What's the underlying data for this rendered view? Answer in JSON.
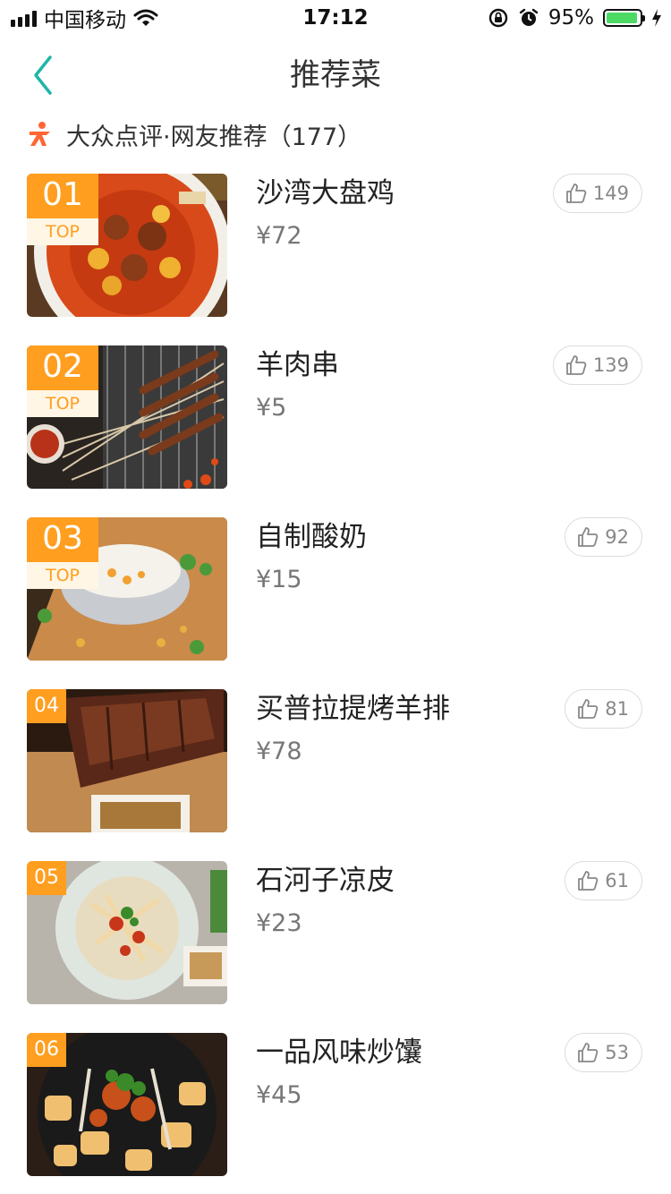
{
  "status_bar": {
    "carrier": "中国移动",
    "time": "17:12",
    "battery": "95%",
    "battery_level": 0.95
  },
  "nav": {
    "title": "推荐菜"
  },
  "source": {
    "text": "大众点评·网友推荐（177）",
    "brand_color": "#ff6633"
  },
  "colors": {
    "rank_badge": "#ff9e1f",
    "back_arrow": "#1fb5a8"
  },
  "dishes": [
    {
      "rank": "01",
      "tag": "TOP",
      "name": "沙湾大盘鸡",
      "price": "¥72",
      "likes": "149",
      "photo": "dapanji-photo"
    },
    {
      "rank": "02",
      "tag": "TOP",
      "name": "羊肉串",
      "price": "¥5",
      "likes": "139",
      "photo": "lamb-skewers-photo"
    },
    {
      "rank": "03",
      "tag": "TOP",
      "name": "自制酸奶",
      "price": "¥15",
      "likes": "92",
      "photo": "yogurt-photo"
    },
    {
      "rank": "04",
      "name": "买普拉提烤羊排",
      "price": "¥78",
      "likes": "81",
      "photo": "lamb-ribs-photo"
    },
    {
      "rank": "05",
      "name": "石河子凉皮",
      "price": "¥23",
      "likes": "61",
      "photo": "liangpi-photo"
    },
    {
      "rank": "06",
      "name": "一品风味炒馕",
      "price": "¥45",
      "likes": "53",
      "photo": "fried-naan-photo"
    }
  ]
}
